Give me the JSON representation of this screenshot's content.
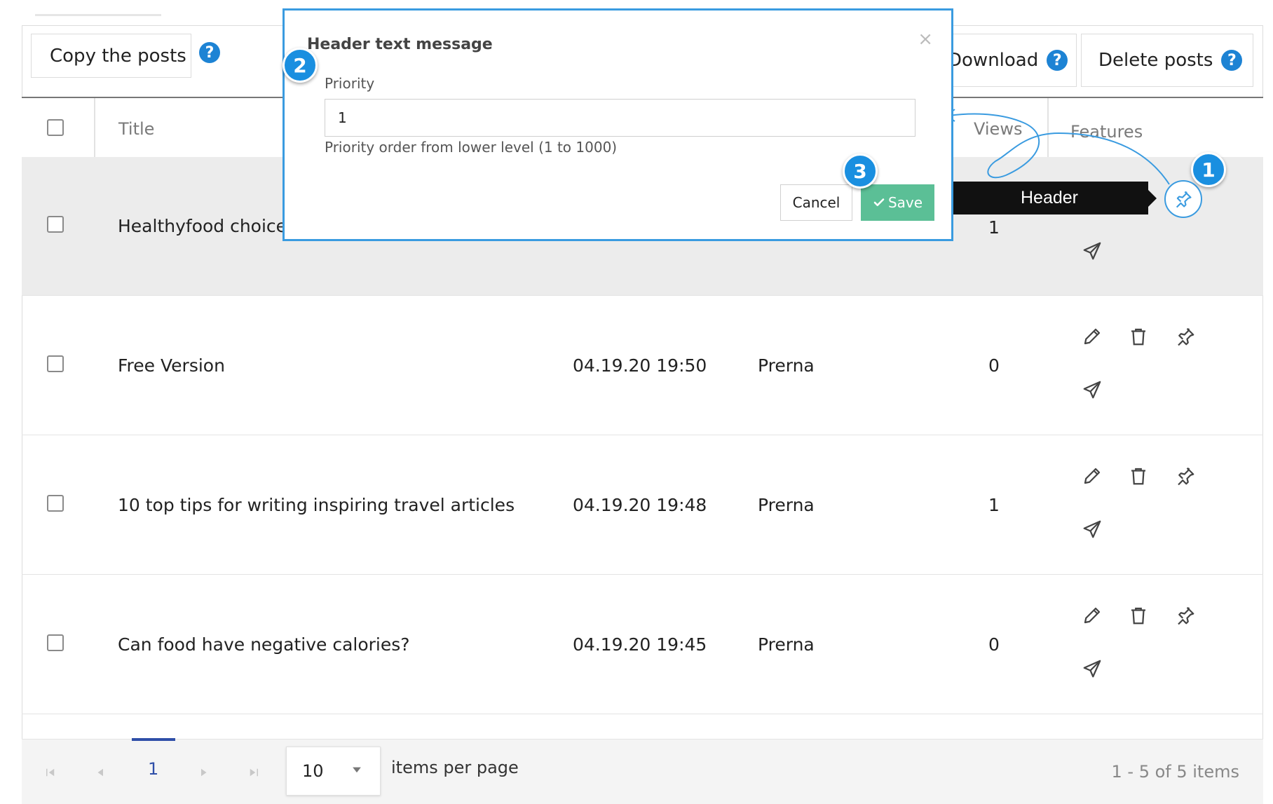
{
  "toolbar": {
    "copy_posts_label": "Copy the posts",
    "download_label": "Download",
    "delete_posts_label": "Delete posts",
    "help_glyph": "?"
  },
  "table": {
    "columns": {
      "title": "Title",
      "views": "Views",
      "features": "Features"
    },
    "rows": [
      {
        "title": "Healthyfood choices",
        "date": "",
        "author": "",
        "views": "1"
      },
      {
        "title": "Free Version",
        "date": "04.19.20 19:50",
        "author": "Prerna",
        "views": "0"
      },
      {
        "title": "10 top tips for writing inspiring travel articles",
        "date": "04.19.20 19:48",
        "author": "Prerna",
        "views": "1"
      },
      {
        "title": "Can food have negative calories?",
        "date": "04.19.20 19:45",
        "author": "Prerna",
        "views": "0"
      }
    ]
  },
  "tooltip": {
    "label": "Header"
  },
  "modal": {
    "title": "Header text message",
    "close_glyph": "×",
    "priority_label": "Priority",
    "priority_value": "1",
    "priority_help": "Priority order from lower level (1 to 1000)",
    "cancel_label": "Cancel",
    "save_label": "Save"
  },
  "badges": {
    "one": "1",
    "two": "2",
    "three": "3"
  },
  "pager": {
    "current_page": "1",
    "page_size": "10",
    "items_per_page_label": "items per page",
    "summary": "1 - 5 of 5 items"
  },
  "colors": {
    "accent_blue": "#1a8fe0",
    "save_green": "#5bbf96",
    "selected_row": "#ececec"
  },
  "icons": {
    "row_actions": [
      "pencil-icon",
      "trash-icon",
      "pin-icon",
      "paper-plane-icon"
    ],
    "pager": [
      "first-page-icon",
      "prev-page-icon",
      "next-page-icon",
      "last-page-icon"
    ]
  }
}
